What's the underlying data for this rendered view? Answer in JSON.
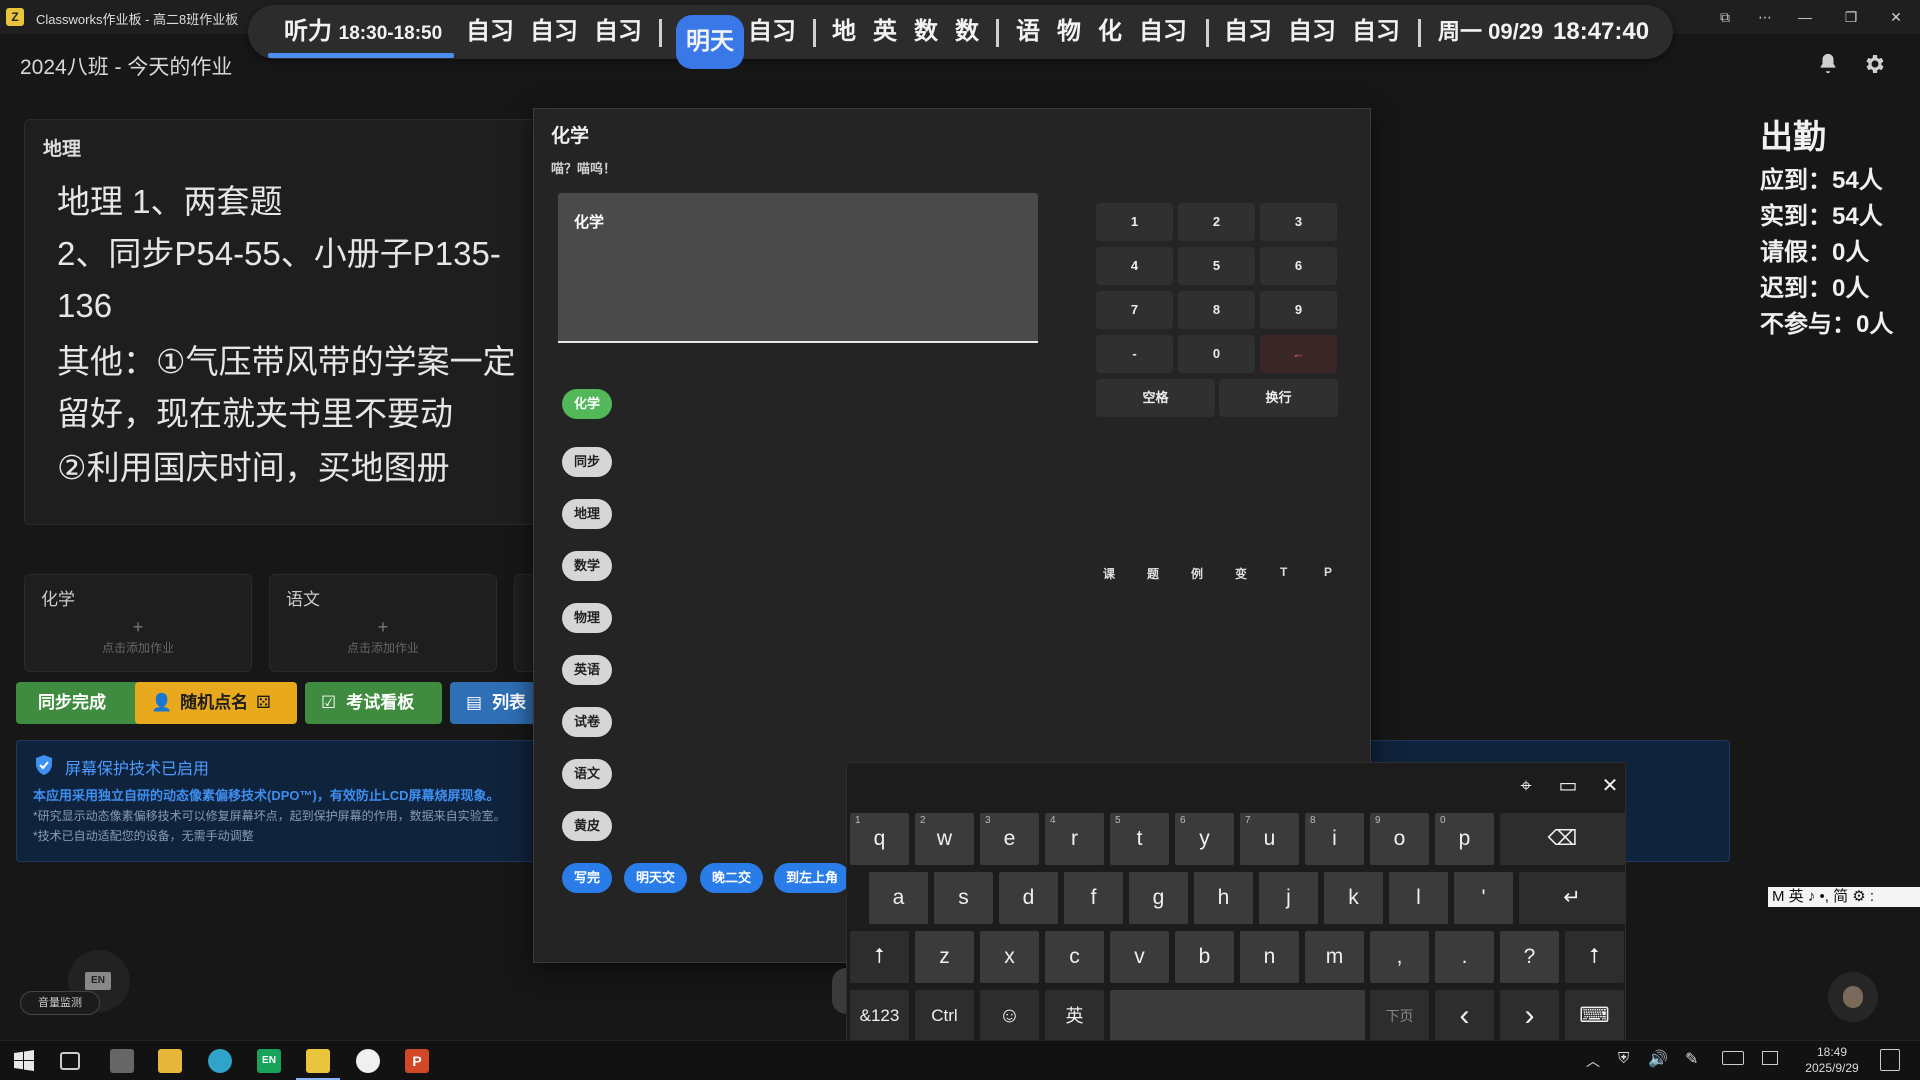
{
  "window": {
    "title": "Classworks作业板 - 高二8班作业板",
    "app_icon_letter": "Z"
  },
  "schedule": {
    "current": "听力",
    "current_time": "18:30-18:50",
    "today_rest": [
      "自习",
      "自习",
      "自习"
    ],
    "tomorrow_label": "明天",
    "tomorrow_groups": [
      [
        "自习"
      ],
      [
        "地",
        "英",
        "数",
        "数"
      ],
      [
        "语",
        "物",
        "化",
        "自习"
      ],
      [
        "自习",
        "自习",
        "自习"
      ]
    ],
    "date": "周一 09/29",
    "clock": "18:47:40"
  },
  "header": {
    "title": "2024八班 - 今天的作业"
  },
  "homework_card": {
    "subject": "地理",
    "lines": [
      "地理 1、两套题",
      "2、同步P54-55、小册子P135-",
      "136",
      "其他：①气压带风带的学案一定",
      "留好，现在就夹书里不要动",
      "②利用国庆时间，买地图册"
    ]
  },
  "small_cards": [
    {
      "subject": "化学",
      "plus": "+",
      "hint": "点击添加作业"
    },
    {
      "subject": "语文",
      "plus": "+",
      "hint": "点击添加作业"
    }
  ],
  "actions": {
    "sync": "同步完成",
    "random": "随机点名",
    "exam": "考试看板",
    "list": "列表"
  },
  "banner": {
    "title": "屏幕保护技术已启用",
    "line1": "本应用采用独立自研的动态像素偏移技术(DPO™)，有效防止LCD屏幕烧屏现象。",
    "line2": "*研究显示动态像素偏移技术可以修复屏幕坏点，起到保护屏幕的作用，数据来自实验室。",
    "line3": "*技术已自动适配您的设备，无需手动调整"
  },
  "attendance": {
    "title": "出勤",
    "rows": [
      "应到：54人",
      "实到：54人",
      "请假：0人",
      "迟到：0人",
      "不参与：0人"
    ]
  },
  "dialog": {
    "title": "化学",
    "subtitle": "喵？喵呜！",
    "text_value": "化学",
    "selected_chip": "化学",
    "subject_chips": [
      "同步",
      "地理",
      "数学",
      "物理",
      "英语",
      "试卷",
      "语文",
      "黄皮"
    ],
    "quick_chips": [
      "写完",
      "明天交",
      "晚二交",
      "到左上角"
    ],
    "numpad": [
      "1",
      "2",
      "3",
      "4",
      "5",
      "6",
      "7",
      "8",
      "9",
      "-",
      "0",
      "←"
    ],
    "space_label": "空格",
    "newline_label": "换行",
    "quick_chars": [
      "课",
      "题",
      "例",
      "变",
      "T",
      "P"
    ]
  },
  "keyboard": {
    "row1": [
      "q",
      "w",
      "e",
      "r",
      "t",
      "y",
      "u",
      "i",
      "o",
      "p"
    ],
    "row1_hints": [
      "1",
      "2",
      "3",
      "4",
      "5",
      "6",
      "7",
      "8",
      "9",
      "0"
    ],
    "row2": [
      "a",
      "s",
      "d",
      "f",
      "g",
      "h",
      "j",
      "k",
      "l",
      "'"
    ],
    "row3": [
      "z",
      "x",
      "c",
      "v",
      "b",
      "n",
      "m",
      ",",
      ".",
      "?"
    ],
    "sym_label": "&123",
    "ctrl_label": "Ctrl",
    "lang_label": "英",
    "next_page_label": "下页"
  },
  "ime_bar": "M 英 ♪ •, 简 ⚙ :",
  "volume_monitor": "音量监测",
  "taskbar": {
    "time": "18:49",
    "date": "2025/9/29"
  }
}
